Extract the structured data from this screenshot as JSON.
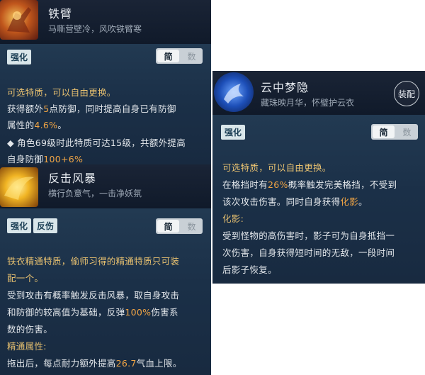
{
  "card1": {
    "name": "铁臂",
    "desc": "马嘶营壁冷，风吹铁臂寒",
    "tags": [
      "强化"
    ],
    "toggle": {
      "on": "简",
      "off": "数"
    },
    "lines": [
      {
        "t": "可选特质，可以自由更换。",
        "style": "gold"
      },
      {
        "parts": [
          [
            "获得额外",
            ""
          ],
          [
            "5",
            "orange"
          ],
          [
            "点防御，同时提高自身已有防御",
            ""
          ]
        ]
      },
      {
        "parts": [
          [
            "属性的",
            ""
          ],
          [
            "4.6%",
            "orange"
          ],
          [
            "。",
            ""
          ]
        ]
      },
      {
        "t": "◆ 角色69级时此特质可达15级，共额外提高",
        "style": ""
      },
      {
        "parts": [
          [
            "自身防御",
            ""
          ],
          [
            "100+6%",
            "orange"
          ]
        ]
      }
    ]
  },
  "card2": {
    "name": "反击风暴",
    "desc": "横行负意气，一击净妖氛",
    "tags": [
      "强化",
      "反伤"
    ],
    "toggle": {
      "on": "简",
      "off": "数"
    },
    "lines": [
      {
        "t": "铁衣精通特质，偷师习得的精通特质只可装",
        "style": "gold"
      },
      {
        "t": "配一个。",
        "style": "gold"
      },
      {
        "t": "受到攻击有概率触发反击风暴，取自身攻击",
        "style": ""
      },
      {
        "parts": [
          [
            "和防御的较高值为基础，反弹",
            ""
          ],
          [
            "100%",
            "orange"
          ],
          [
            "伤害系",
            ""
          ]
        ]
      },
      {
        "t": "数的伤害。",
        "style": ""
      },
      {
        "t": "精通属性:",
        "style": "gold"
      },
      {
        "parts": [
          [
            "拖出后，每点耐力额外提高",
            ""
          ],
          [
            "26.7",
            "orange"
          ],
          [
            "气血上限。",
            ""
          ]
        ]
      }
    ]
  },
  "card3": {
    "name": "云中梦隐",
    "desc": "藏珠映月华，怀璧护云衣",
    "equip": "装配",
    "tags": [
      "强化"
    ],
    "toggle": {
      "on": "简",
      "off": "数"
    },
    "lines": [
      {
        "t": "可选特质，可以自由更换。",
        "style": "gold"
      },
      {
        "parts": [
          [
            "在格挡时有",
            ""
          ],
          [
            "26%",
            "orange"
          ],
          [
            "概率触发完美格挡，不受到",
            ""
          ]
        ]
      },
      {
        "t": "该次攻击伤害。同时自身获得化影。",
        "style": "",
        "hl": "化影"
      },
      {
        "t": "化影:",
        "style": "gold"
      },
      {
        "t": "受到怪物的高伤害时，影子可为自身抵挡一",
        "style": ""
      },
      {
        "t": "次伤害，自身获得短时间的无敌，一段时间",
        "style": ""
      },
      {
        "t": "后影子恢复。",
        "style": ""
      }
    ]
  }
}
